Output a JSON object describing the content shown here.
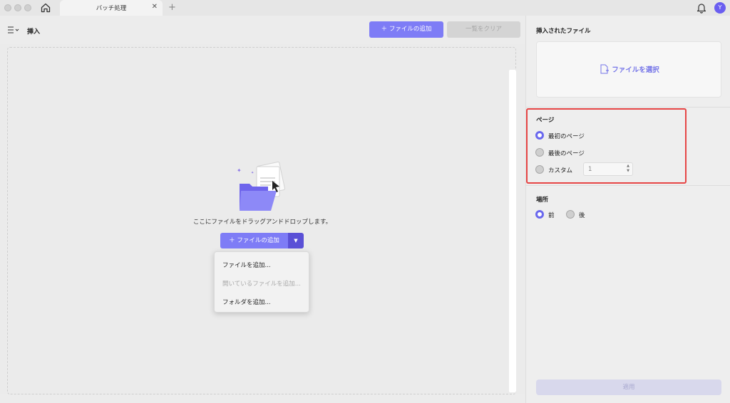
{
  "titlebar": {
    "tab_label": "バッチ処理",
    "tab_close": "✕",
    "tab_add": "+",
    "avatar_initial": "Y"
  },
  "toolbar": {
    "title": "挿入",
    "add_file_label": "＋  ファイルの追加",
    "clear_label": "一覧をクリア"
  },
  "droparea": {
    "instruction": "ここにファイルをドラッグアンドドロップします。",
    "add_file_label": "＋  ファイルの追加",
    "dropdown_caret": "▼",
    "dropdown_items": [
      {
        "label": "ファイルを追加...",
        "enabled": true
      },
      {
        "label": "開いているファイルを追加...",
        "enabled": false
      },
      {
        "label": "フォルダを追加...",
        "enabled": true
      }
    ]
  },
  "right_panel": {
    "inserted_title": "挿入されたファイル",
    "select_file_label": "ファイルを選択",
    "page_section": {
      "title": "ページ",
      "options": [
        {
          "label": "最初のページ",
          "selected": true
        },
        {
          "label": "最後のページ",
          "selected": false
        },
        {
          "label": "カスタム",
          "selected": false
        }
      ],
      "custom_value": "1"
    },
    "location_section": {
      "title": "場所",
      "options": [
        {
          "label": "前",
          "selected": true
        },
        {
          "label": "後",
          "selected": false
        }
      ]
    },
    "apply_label": "適用"
  },
  "colors": {
    "accent": "#7e7cf6",
    "accent_dark": "#5a50d6",
    "highlight_border": "#e64545",
    "radio_on": "#6a68ee"
  }
}
